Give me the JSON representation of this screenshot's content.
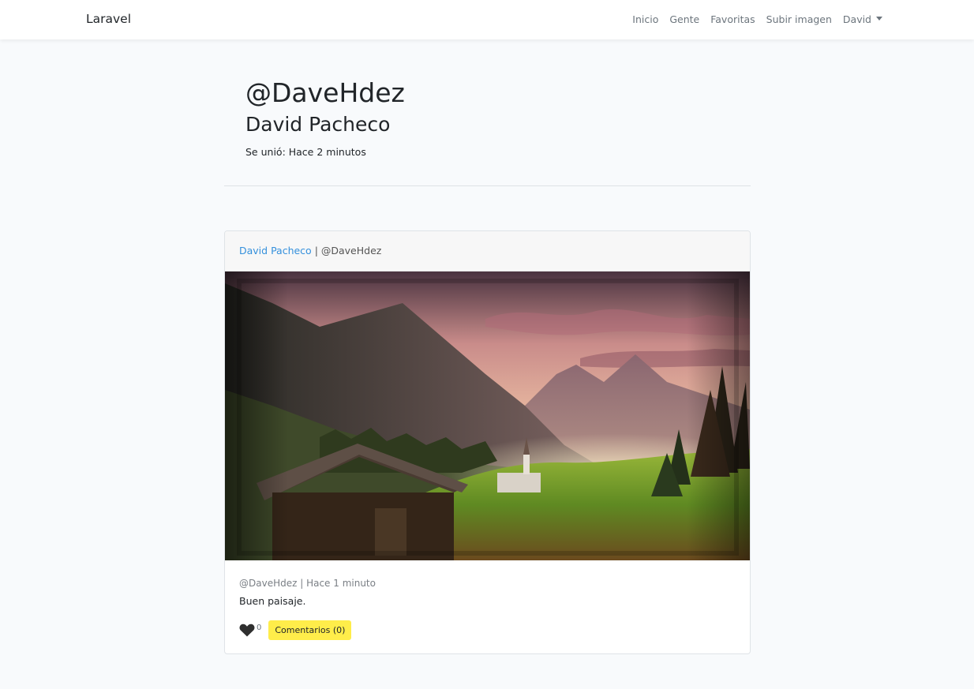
{
  "navbar": {
    "brand": "Laravel",
    "links": [
      "Inicio",
      "Gente",
      "Favoritas",
      "Subir imagen"
    ],
    "user_menu": "David"
  },
  "profile": {
    "nick": "@DaveHdez",
    "full_name": "David Pacheco",
    "joined": "Se unió: Hace 2 minutos"
  },
  "post": {
    "author_name": "David Pacheco",
    "author_separator": " | @DaveHdez",
    "meta": "@DaveHdez | Hace 1 minuto",
    "description": "Buen paisaje.",
    "like_count": "0",
    "comments_label": "Comentarios (0)"
  },
  "colors": {
    "link": "#3490dc",
    "comments_button": "#ffed4a",
    "background": "#f8fafc"
  }
}
